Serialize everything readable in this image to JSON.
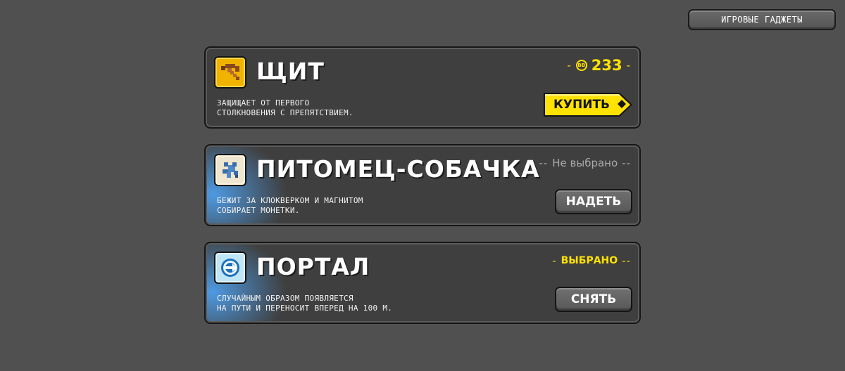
{
  "header": {
    "gadgets_button": "ИГРОВЫЕ ГАДЖЕТЫ"
  },
  "cards": [
    {
      "title": "ЩИТ",
      "description_line1": "ЗАЩИЩАЕТ ОТ ПЕРВОГО",
      "description_line2": "СТОЛКНОВЕНИЯ С ПРЕПЯТСТВИЕМ.",
      "coin_label": "BB",
      "price": "233",
      "action": "КУПИТЬ",
      "icon": "pickaxe-icon"
    },
    {
      "title": "ПИТОМЕЦ-СОБАЧКА",
      "description_line1": "БЕЖИТ ЗА КЛОКВЕРКОМ И МАГНИТОМ",
      "description_line2": "СОБИРАЕТ МОНЕТКИ.",
      "status": "Не выбрано",
      "action": "НАДЕТЬ",
      "icon": "dog-pet-icon"
    },
    {
      "title": "ПОРТАЛ",
      "description_line1": "СЛУЧАЙНЫМ ОБРАЗОМ ПОЯВЛЯЕТСЯ",
      "description_line2": "НА ПУТИ И ПЕРЕНОСИТ ВПЕРЕД НА 100 М.",
      "status": "ВЫБРАНО",
      "action": "СНЯТЬ",
      "icon": "portal-icon"
    }
  ],
  "status_dash": "-- ",
  "colors": {
    "background": "#505050",
    "card": "#3f3f3f",
    "accent": "#ffe200",
    "glow": "#50aaff"
  }
}
